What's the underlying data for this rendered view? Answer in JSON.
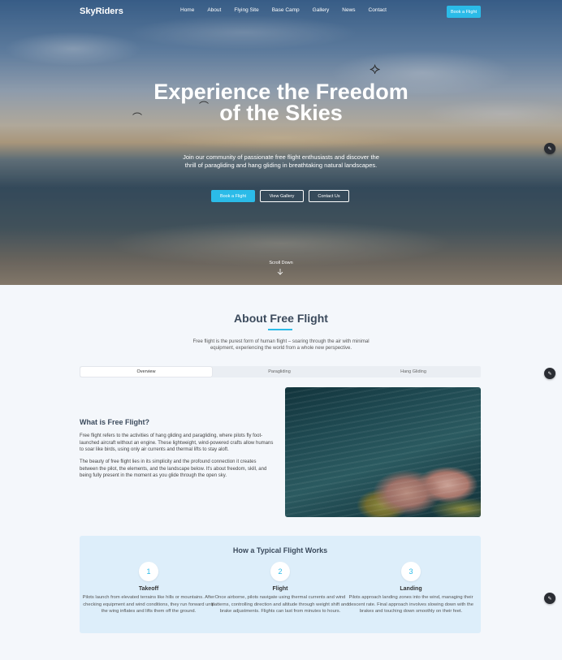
{
  "header": {
    "logo": "SkyRiders",
    "nav": [
      "Home",
      "About",
      "Flying Site",
      "Base Camp",
      "Gallery",
      "News",
      "Contact"
    ],
    "book_button": "Book a Flight"
  },
  "hero": {
    "title": "Experience the Freedom of the Skies",
    "subtitle": "Join our community of passionate free flight enthusiasts and discover the thrill of paragliding and hang gliding in breathtaking natural landscapes.",
    "buttons": {
      "book": "Book a Flight",
      "gallery": "View Gallery",
      "contact": "Contact Us"
    },
    "scroll_label": "Scroll Down"
  },
  "about": {
    "title": "About Free Flight",
    "description": "Free flight is the purest form of human flight – soaring through the air with minimal equipment, experiencing the world from a whole new perspective.",
    "tabs": [
      "Overview",
      "Paragliding",
      "Hang Gliding"
    ],
    "active_tab": "Overview",
    "content": {
      "heading": "What is Free Flight?",
      "p1": "Free flight refers to the activities of hang gliding and paragliding, where pilots fly foot-launched aircraft without an engine. These lightweight, wind-powered crafts allow humans to soar like birds, using only air currents and thermal lifts to stay aloft.",
      "p2": "The beauty of free flight lies in its simplicity and the profound connection it creates between the pilot, the elements, and the landscape below. It's about freedom, skill, and being fully present in the moment as you glide through the open sky."
    }
  },
  "how": {
    "title": "How a Typical Flight Works",
    "steps": [
      {
        "num": "1",
        "title": "Takeoff",
        "desc": "Pilots launch from elevated terrains like hills or mountains. After checking equipment and wind conditions, they run forward until the wing inflates and lifts them off the ground."
      },
      {
        "num": "2",
        "title": "Flight",
        "desc": "Once airborne, pilots navigate using thermal currents and wind patterns, controlling direction and altitude through weight shift and brake adjustments. Flights can last from minutes to hours."
      },
      {
        "num": "3",
        "title": "Landing",
        "desc": "Pilots approach landing zones into the wind, managing their descent rate. Final approach involves slowing down with the brakes and touching down smoothly on their feet."
      }
    ]
  },
  "icons": {
    "scroll": "arrow-down-icon",
    "widget": "chat-widget-icon",
    "bird": "bird-icon"
  },
  "colors": {
    "accent": "#2bbbe8",
    "heading": "#3b4a5c"
  }
}
